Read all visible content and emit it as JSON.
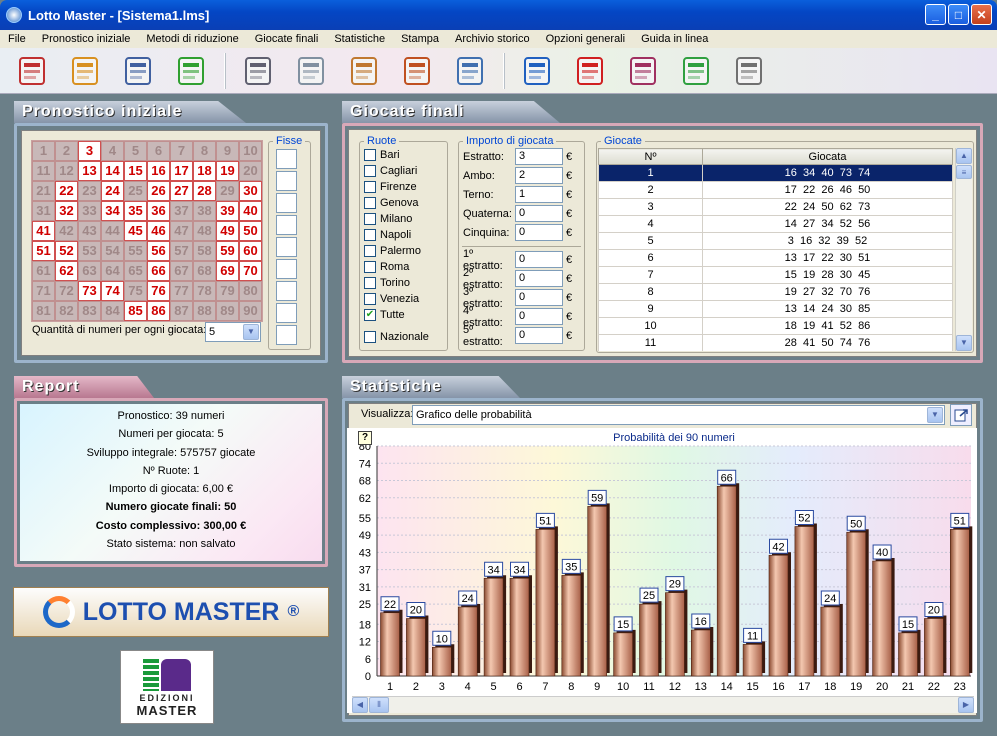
{
  "window": {
    "title": "Lotto Master - [Sistema1.lms]",
    "min": "_",
    "max": "□",
    "close": "✕"
  },
  "menu": [
    "File",
    "Pronostico iniziale",
    "Metodi di riduzione",
    "Giocate finali",
    "Statistiche",
    "Stampa",
    "Archivio storico",
    "Opzioni generali",
    "Guida in linea"
  ],
  "toolbar": [
    "new-document-icon",
    "open-folder-icon",
    "save-disk-icon",
    "wizard-icon",
    "reduction-icon",
    "gears-icon",
    "archive-icon",
    "clock-icon",
    "calendar-icon",
    "refresh-icon",
    "delete-icon",
    "edit-icon",
    "tree-icon",
    "print-icon"
  ],
  "pronostico": {
    "title": "Pronostico iniziale",
    "fisse_label": "Fisse",
    "qty_label": "Quantità di numeri per ogni giocata:",
    "qty_value": "5",
    "selected": [
      3,
      13,
      14,
      15,
      16,
      17,
      18,
      19,
      22,
      24,
      26,
      27,
      28,
      30,
      32,
      34,
      35,
      36,
      39,
      40,
      41,
      45,
      46,
      49,
      50,
      51,
      52,
      56,
      59,
      60,
      62,
      66,
      69,
      70,
      73,
      74,
      76,
      85,
      86
    ]
  },
  "giocate": {
    "title": "Giocate finali",
    "ruote_label": "Ruote",
    "ruote": [
      {
        "name": "Bari",
        "checked": false
      },
      {
        "name": "Cagliari",
        "checked": false
      },
      {
        "name": "Firenze",
        "checked": false
      },
      {
        "name": "Genova",
        "checked": false
      },
      {
        "name": "Milano",
        "checked": false
      },
      {
        "name": "Napoli",
        "checked": false
      },
      {
        "name": "Palermo",
        "checked": false
      },
      {
        "name": "Roma",
        "checked": false
      },
      {
        "name": "Torino",
        "checked": false
      },
      {
        "name": "Venezia",
        "checked": false
      },
      {
        "name": "Tutte",
        "checked": true
      }
    ],
    "nazionale": "Nazionale",
    "importo_label": "Importo di giocata",
    "importi": [
      {
        "label": "Estratto:",
        "value": "3"
      },
      {
        "label": "Ambo:",
        "value": "2"
      },
      {
        "label": "Terno:",
        "value": "1"
      },
      {
        "label": "Quaterna:",
        "value": "0"
      },
      {
        "label": "Cinquina:",
        "value": "0"
      }
    ],
    "estratti": [
      {
        "label": "1º estratto:",
        "value": "0"
      },
      {
        "label": "2º estratto:",
        "value": "0"
      },
      {
        "label": "3º estratto:",
        "value": "0"
      },
      {
        "label": "4º estratto:",
        "value": "0"
      },
      {
        "label": "5º estratto:",
        "value": "0"
      }
    ],
    "euro": "€",
    "table_label": "Giocate",
    "col_n": "Nº",
    "col_g": "Giocata",
    "rows": [
      [
        "1",
        "16  34  40  73  74"
      ],
      [
        "2",
        "17  22  26  46  50"
      ],
      [
        "3",
        "22  24  50  62  73"
      ],
      [
        "4",
        "14  27  34  52  56"
      ],
      [
        "5",
        "3  16  32  39  52"
      ],
      [
        "6",
        "13  17  22  30  51"
      ],
      [
        "7",
        "15  19  28  30  45"
      ],
      [
        "8",
        "19  27  32  70  76"
      ],
      [
        "9",
        "13  14  24  30  85"
      ],
      [
        "10",
        "18  19  41  52  86"
      ],
      [
        "11",
        "28  41  50  74  76"
      ]
    ]
  },
  "report": {
    "title": "Report",
    "lines": [
      {
        "text": "Pronostico: 39 numeri",
        "bold": false
      },
      {
        "text": "Numeri per giocata: 5",
        "bold": false
      },
      {
        "text": "Sviluppo integrale: 575757 giocate",
        "bold": false
      },
      {
        "text": "Nº Ruote: 1",
        "bold": false
      },
      {
        "text": "Importo di giocata: 6,00 €",
        "bold": false
      },
      {
        "text": "Numero giocate finali: 50",
        "bold": true
      },
      {
        "text": "Costo complessivo: 300,00 €",
        "bold": true
      },
      {
        "text": "Stato sistema: non salvato",
        "bold": false
      }
    ]
  },
  "logo": {
    "text": "LOTTO MASTER",
    "reg": "®"
  },
  "edizioni": {
    "line1": "EDIZIONI",
    "line2": "MASTER"
  },
  "stats": {
    "title": "Statistiche",
    "visualizza_label": "Visualizza:",
    "visualizza_value": "Grafico delle probabilità",
    "help": "?"
  },
  "chart_data": {
    "type": "bar",
    "title": "Probabilità dei 90 numeri",
    "ylim": [
      0,
      80
    ],
    "yticks": [
      "0",
      "6",
      "12",
      "18",
      "25",
      "31",
      "37",
      "43",
      "49",
      "55",
      "62",
      "68",
      "74",
      "80"
    ],
    "categories": [
      "1",
      "2",
      "3",
      "4",
      "5",
      "6",
      "7",
      "8",
      "9",
      "10",
      "11",
      "12",
      "13",
      "14",
      "15",
      "16",
      "17",
      "18",
      "19",
      "20",
      "21",
      "22",
      "23"
    ],
    "values": [
      22,
      20,
      10,
      24,
      34,
      34,
      51,
      35,
      59,
      15,
      25,
      29,
      16,
      66,
      11,
      42,
      52,
      24,
      50,
      40,
      15,
      20,
      51
    ]
  }
}
